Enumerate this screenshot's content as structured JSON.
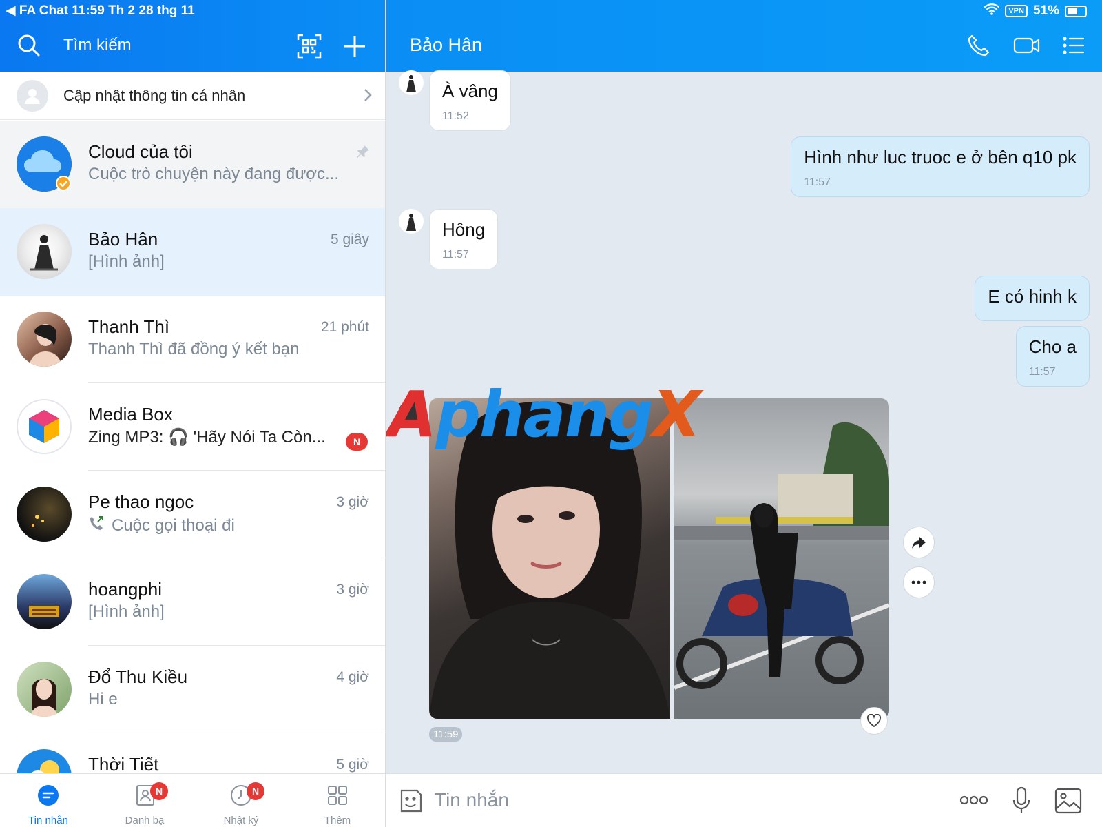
{
  "status_bar": {
    "left": "◀ FA Chat   11:59   Th 2 28 thg 11",
    "vpn": "VPN",
    "battery": "51%"
  },
  "sidebar": {
    "search_label": "Tìm kiếm",
    "profile_update_label": "Cập nhật thông tin cá nhân",
    "conversations": [
      {
        "name": "Cloud của tôi",
        "preview": "Cuộc trò chuyện này đang được...",
        "time": ""
      },
      {
        "name": "Bảo Hân",
        "preview": "[Hình ảnh]",
        "time": "5 giây"
      },
      {
        "name": "Thanh Thì",
        "preview": "Thanh Thì đã đồng ý kết bạn",
        "time": "21 phút"
      },
      {
        "name": "Media Box",
        "preview": "Zing MP3: 🎧 'Hãy Nói Ta Còn...",
        "time": "",
        "badge": "N"
      },
      {
        "name": "Pe thao ngoc",
        "preview": "Cuộc gọi thoại đi",
        "time": "3 giờ"
      },
      {
        "name": "hoangphi",
        "preview": "[Hình ảnh]",
        "time": "3 giờ"
      },
      {
        "name": "Đổ Thu Kiều",
        "preview": "Hi e",
        "time": "4 giờ"
      },
      {
        "name": "Thời Tiết",
        "preview": "",
        "time": "5 giờ"
      }
    ]
  },
  "bottom_nav": {
    "items": [
      {
        "label": "Tin nhắn",
        "badge": ""
      },
      {
        "label": "Danh bạ",
        "badge": "N"
      },
      {
        "label": "Nhật ký",
        "badge": "N"
      },
      {
        "label": "Thêm",
        "badge": ""
      }
    ]
  },
  "chat": {
    "title": "Bảo Hân",
    "messages": [
      {
        "text": "À vâng",
        "time": "11:52",
        "side": "left"
      },
      {
        "text": "Hình như luc truoc e ở bên q10 pk",
        "time": "11:57",
        "side": "right"
      },
      {
        "text": "Hông",
        "time": "11:57",
        "side": "left"
      },
      {
        "text": "E có hinh k",
        "time": "",
        "side": "right"
      },
      {
        "text": "Cho a",
        "time": "11:57",
        "side": "right"
      }
    ],
    "photo_time": "11:59",
    "composer_placeholder": "Tin nhắn"
  },
  "watermark": {
    "part1": "A",
    "part2": "phang",
    "part3": "X"
  },
  "colors": {
    "accent": "#0a8ef5",
    "badge": "#e53935",
    "bubble_mine": "#d5ecfb"
  }
}
